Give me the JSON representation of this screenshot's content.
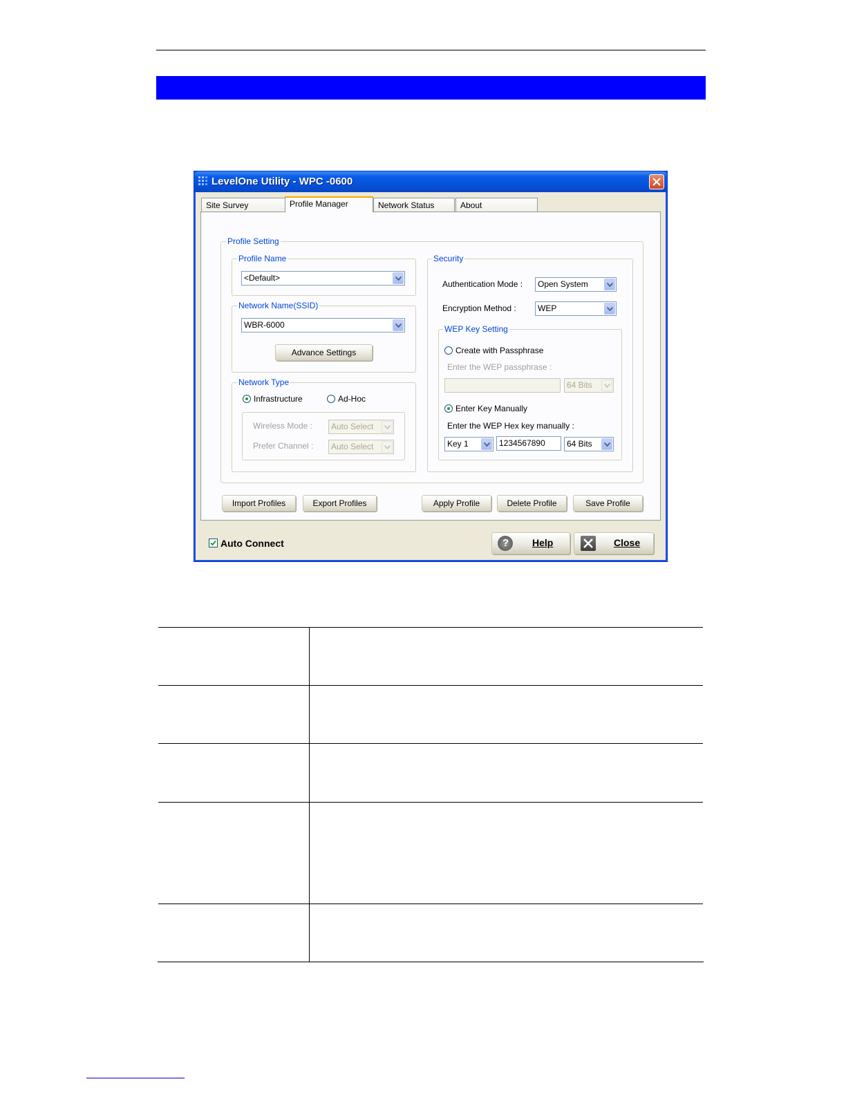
{
  "window": {
    "title": "LevelOne Utility - WPC -0600",
    "tabs": [
      {
        "label": "Site Survey"
      },
      {
        "label": "Profile Manager"
      },
      {
        "label": "Network Status"
      },
      {
        "label": "About"
      }
    ],
    "active_tab": "Profile Manager"
  },
  "profile_setting": {
    "label": "Profile Setting",
    "profile_name": {
      "label": "Profile Name",
      "value": "<Default>"
    },
    "network_name": {
      "label": "Network Name(SSID)",
      "value": "WBR-6000",
      "advance_button": "Advance Settings"
    },
    "network_type": {
      "label": "Network Type",
      "infrastructure": "Infrastructure",
      "adhoc": "Ad-Hoc",
      "selected": "Infrastructure",
      "wireless_mode_label": "Wireless Mode :",
      "wireless_mode_value": "Auto Select",
      "prefer_channel_label": "Prefer Channel :",
      "prefer_channel_value": "Auto Select"
    }
  },
  "security": {
    "label": "Security",
    "auth_label": "Authentication Mode :",
    "auth_value": "Open System",
    "enc_label": "Encryption Method :",
    "enc_value": "WEP",
    "wep": {
      "label": "WEP Key Setting",
      "passphrase_radio": "Create with Passphrase",
      "passphrase_prompt": "Enter the WEP passphrase :",
      "passphrase_value": "",
      "passphrase_bits": "64 Bits",
      "manual_radio": "Enter Key Manually",
      "manual_prompt": "Enter the WEP Hex key manually :",
      "key_index": "Key 1",
      "key_value": "1234567890",
      "key_bits": "64 Bits",
      "selected": "Enter Key Manually"
    }
  },
  "buttons": {
    "import": "Import Profiles",
    "export": "Export Profiles",
    "apply": "Apply  Profile",
    "delete": "Delete Profile",
    "save": "Save Profile"
  },
  "footer": {
    "auto_connect": "Auto Connect",
    "auto_connect_checked": true,
    "help": "Help",
    "close": "Close"
  },
  "colors": {
    "band": "#0000ff",
    "titlebar": "#0550d7",
    "group_label": "#0046d5"
  }
}
